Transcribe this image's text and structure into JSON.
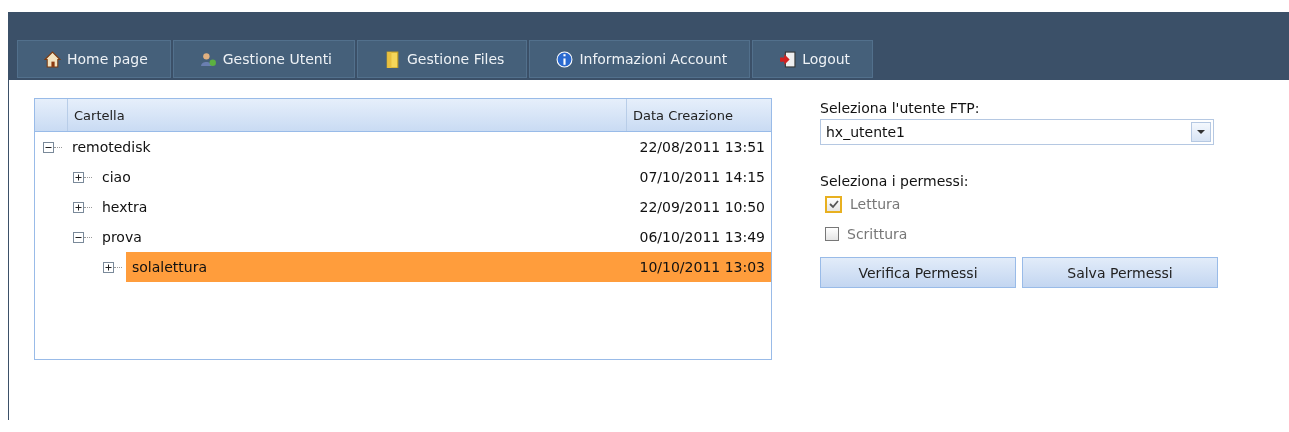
{
  "nav_tabs": [
    {
      "kind": "home",
      "label": "Home page"
    },
    {
      "kind": "users",
      "label": "Gestione Utenti"
    },
    {
      "kind": "files",
      "label": "Gestione Files"
    },
    {
      "kind": "info",
      "label": "Informazioni Account"
    },
    {
      "kind": "logout",
      "label": "Logout"
    }
  ],
  "tree": {
    "columns": [
      "Cartella",
      "Data Creazione"
    ],
    "nodes": [
      {
        "name": "remotedisk",
        "date": "22/08/2011 13:51",
        "expanded": true,
        "selected": false,
        "children": [
          {
            "name": "ciao",
            "date": "07/10/2011 14:15",
            "expanded": false,
            "selected": false
          },
          {
            "name": "hextra",
            "date": "22/09/2011 10:50",
            "expanded": false,
            "selected": false
          },
          {
            "name": "prova",
            "date": "06/10/2011 13:49",
            "expanded": true,
            "selected": false,
            "children": [
              {
                "name": "solalettura",
                "date": "10/10/2011 13:03",
                "expanded": false,
                "selected": true
              }
            ]
          }
        ]
      }
    ]
  },
  "user_select": {
    "label": "Seleziona l'utente FTP:",
    "value": "hx_utente1"
  },
  "permissions": {
    "label": "Seleziona i permessi:",
    "options": [
      {
        "label": "Lettura",
        "checked": true,
        "focused": true,
        "disabled": true
      },
      {
        "label": "Scrittura",
        "checked": false,
        "focused": false,
        "disabled": true
      }
    ]
  },
  "buttons": [
    "Verifica Permessi",
    "Salva Permessi"
  ]
}
